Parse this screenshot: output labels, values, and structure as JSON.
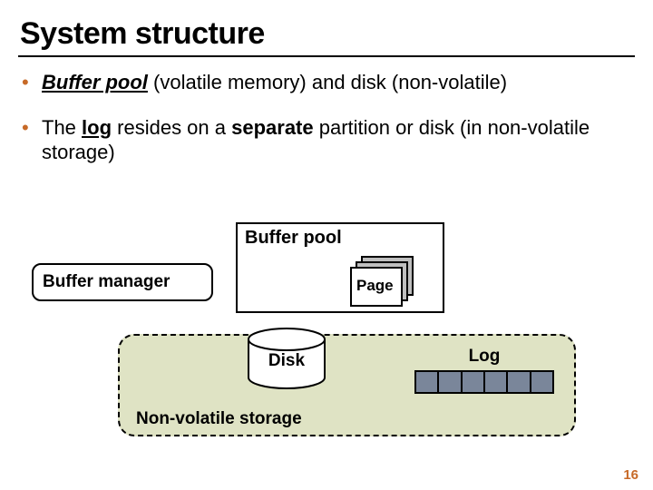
{
  "title": "System structure",
  "bullets": [
    {
      "lead_bold_italic": "Buffer pool",
      "lead_underline": true,
      "rest": " (volatile memory) and disk (non-volatile)"
    }
  ],
  "bullet2_parts": {
    "pre": "The ",
    "log_word": "log",
    "mid": " resides on a ",
    "sep_word": "separate",
    "post": " partition or disk (in non-volatile storage)"
  },
  "diagram": {
    "buffer_pool_label": "Buffer pool",
    "page_label": "Page",
    "buffer_manager_label": "Buffer manager",
    "nv_storage_label": "Non-volatile storage",
    "disk_label": "Disk",
    "log_label": "Log",
    "log_cells": 6
  },
  "page_number": "16"
}
